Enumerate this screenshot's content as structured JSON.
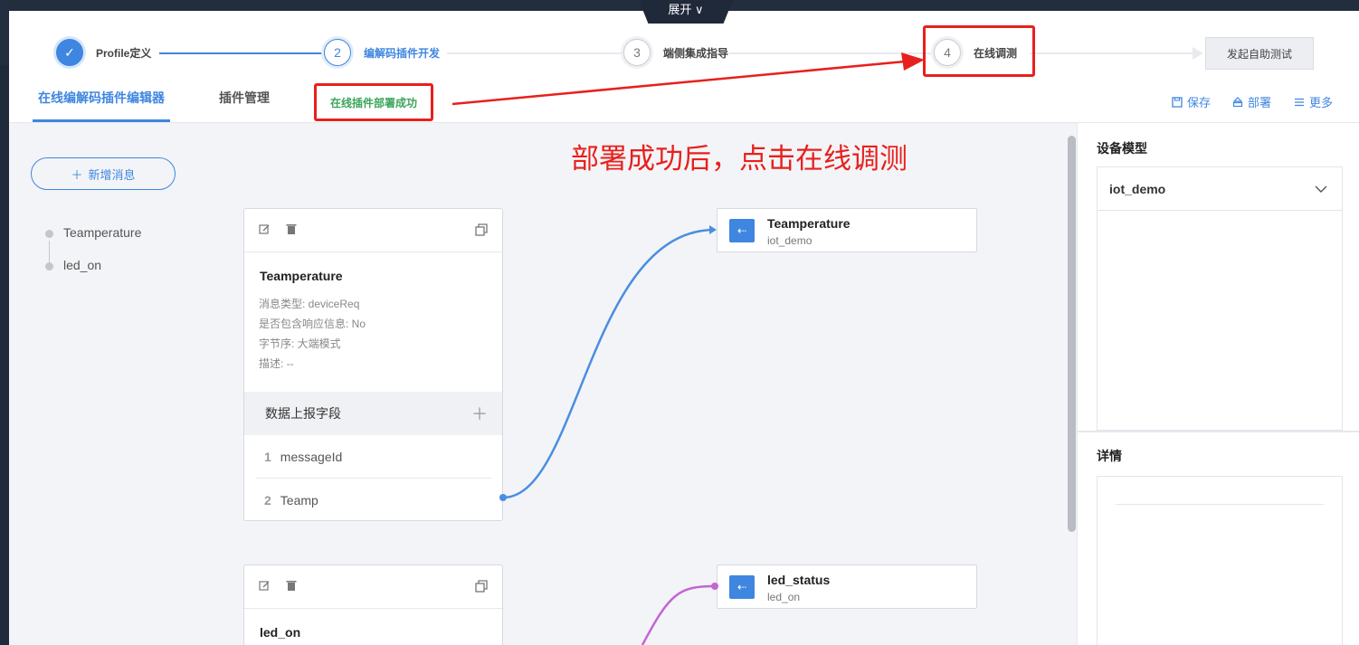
{
  "expand_label": "展开",
  "steps": [
    {
      "number": "✓",
      "label": "Profile定义",
      "state": "done"
    },
    {
      "number": "2",
      "label": "编解码插件开发",
      "state": "active"
    },
    {
      "number": "3",
      "label": "端侧集成指导",
      "state": "pending"
    },
    {
      "number": "4",
      "label": "在线调测",
      "state": "pending"
    }
  ],
  "start_test_label": "发起自助测试",
  "tabs": {
    "editor": "在线编解码插件编辑器",
    "manage": "插件管理"
  },
  "deploy_status": "在线插件部署成功",
  "toolbar": {
    "save": "保存",
    "deploy": "部署",
    "more": "更多"
  },
  "annotation": "部署成功后，点击在线调测",
  "add_message_label": "新增消息",
  "message_list": [
    "Teamperature",
    "led_on"
  ],
  "messages": [
    {
      "title": "Teamperature",
      "meta": [
        "消息类型: deviceReq",
        "是否包含响应信息: No",
        "字节序: 大端模式",
        "描述: --"
      ],
      "fields_header": "数据上报字段",
      "fields": [
        {
          "num": "1",
          "name": "messageId"
        },
        {
          "num": "2",
          "name": "Teamp"
        }
      ]
    },
    {
      "title": "led_on"
    }
  ],
  "properties": [
    {
      "title": "Teamperature",
      "sub": "iot_demo"
    },
    {
      "title": "led_status",
      "sub": "led_on"
    }
  ],
  "right_panel": {
    "device_model_title": "设备模型",
    "device_model_value": "iot_demo",
    "detail_title": "详情"
  },
  "colors": {
    "accent": "#3f86e0",
    "annotation_red": "#e8201d",
    "success_green": "#3aa55a",
    "link_purple": "#c266d4"
  }
}
